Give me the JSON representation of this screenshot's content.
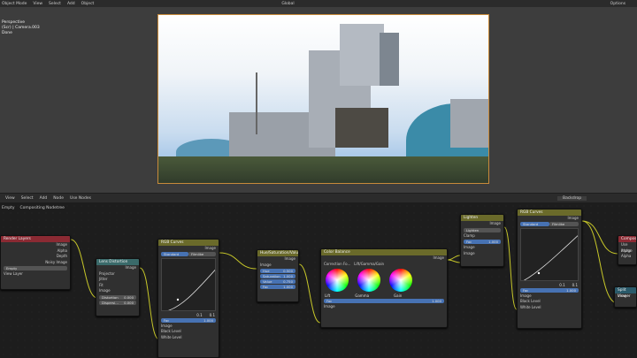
{
  "topbar": {
    "mode": "Object Mode",
    "menus": [
      "View",
      "Select",
      "Add",
      "Object"
    ],
    "transform": "Global",
    "options": "Options"
  },
  "viewport_overlay": {
    "line1": "Perspective",
    "line2": "(Scr) | Camera.003",
    "line3": "Done"
  },
  "nodebar": {
    "menus": [
      "View",
      "Select",
      "Add",
      "Node"
    ],
    "use_nodes": "Use Nodes",
    "backdrop": "Backdrop"
  },
  "breadcrumb": {
    "scene": "Empty",
    "tree": "Compositing Nodetree"
  },
  "nodes": {
    "render_layers": {
      "title": "Render Layers",
      "outputs": [
        "Image",
        "Alpha",
        "Depth",
        "Noisy Image"
      ],
      "scene": "Empty",
      "layer": "View Layer"
    },
    "lens": {
      "title": "Lens Distortion",
      "output": "Image",
      "opt1": "Projector",
      "opt2": "Jitter",
      "opt3": "Fit",
      "input": "Image",
      "f1": "Distortion",
      "v1": "0.000",
      "f2": "Dispersi...",
      "v2": "0.000"
    },
    "rgb1": {
      "title": "RGB Curves",
      "output": "Image",
      "tab1": "Standard",
      "tab2": "Filmlike",
      "fac": "Fac",
      "facv": "1.000",
      "in1": "Image",
      "in2": "Black Level",
      "in3": "White Level",
      "p1": "0.1",
      "p2": "0.1"
    },
    "hsv": {
      "title": "Hue/Saturation/Value",
      "output": "Image",
      "input": "Image",
      "fields": [
        [
          "Hue",
          "0.500"
        ],
        [
          "Saturation",
          "1.000"
        ],
        [
          "Value",
          "0.750"
        ],
        [
          "Fac",
          "1.000"
        ]
      ]
    },
    "cb": {
      "title": "Color Balance",
      "output": "Image",
      "corr": "Correction Fo...",
      "mode": "Lift/Gamma/Gain",
      "l1": "Lift",
      "l2": "Gamma",
      "l3": "Gain",
      "fac": "Fac",
      "facv": "1.000",
      "input": "Image"
    },
    "lighten": {
      "title": "Lighten",
      "output": "Image",
      "mode": "Lighten",
      "clamp": "Clamp",
      "fac": "Fac",
      "facv": "1.000",
      "in1": "Image",
      "in2": "Image"
    },
    "rgb2": {
      "title": "RGB Curves",
      "output": "Image",
      "tab1": "Standard",
      "tab2": "Filmlike",
      "fac": "Fac",
      "facv": "1.000",
      "in1": "Image",
      "in2": "Black Level",
      "in3": "White Level",
      "p1": "0.1",
      "p2": "0.1"
    },
    "composite": {
      "title": "Composite",
      "opt": "Use Alpha",
      "in1": "Image",
      "in2": "Alpha"
    },
    "viewer": {
      "title": "Split Viewer",
      "in1": "Image"
    }
  }
}
